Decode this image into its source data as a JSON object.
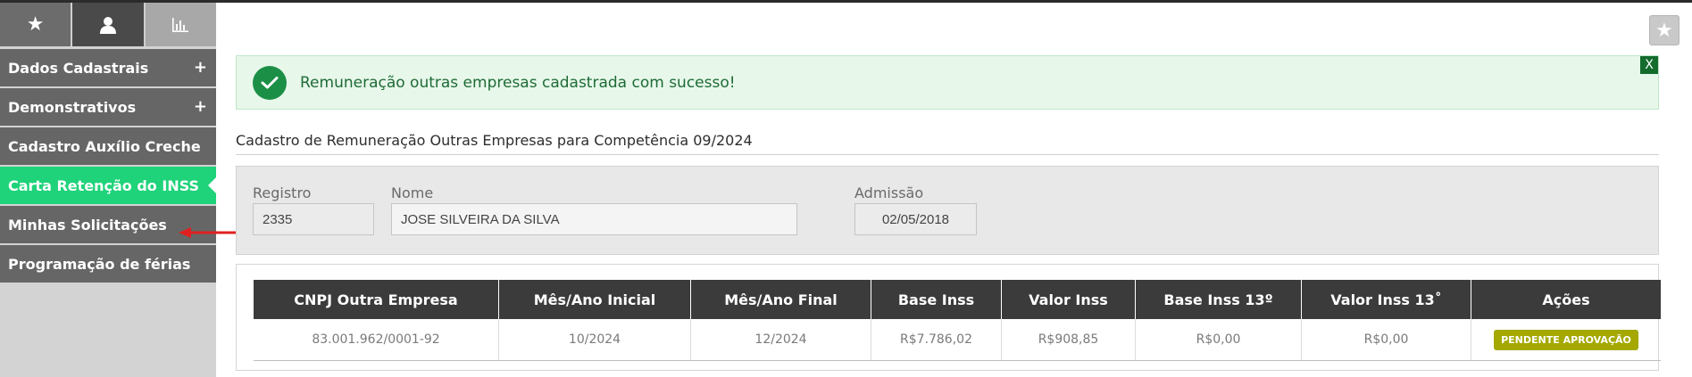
{
  "sidebar": {
    "tabs": [
      {
        "icon": "star-icon",
        "glyph": "★"
      },
      {
        "icon": "user-icon",
        "glyph": "👤"
      },
      {
        "icon": "bar-chart-icon",
        "glyph": "📊"
      }
    ],
    "items": [
      {
        "label": "Dados Cadastrais",
        "expand": "+"
      },
      {
        "label": "Demonstrativos",
        "expand": "+"
      },
      {
        "label": "Cadastro Auxílio Creche"
      },
      {
        "label": "Carta Retenção do INSS"
      },
      {
        "label": "Minhas Solicitações"
      },
      {
        "label": "Programação de férias"
      }
    ]
  },
  "alert": {
    "message": "Remuneração outras empresas cadastrada com sucesso!",
    "close_label": "X"
  },
  "favorite": {
    "glyph": "★"
  },
  "section": {
    "title": "Cadastro de Remuneração Outras Empresas para Competência 09/2024"
  },
  "form": {
    "registro": {
      "label": "Registro",
      "value": "2335"
    },
    "nome": {
      "label": "Nome",
      "value": "JOSE SILVEIRA DA SILVA"
    },
    "admissao": {
      "label": "Admissão",
      "value": "02/05/2018"
    }
  },
  "table": {
    "headers": [
      "CNPJ Outra Empresa",
      "Mês/Ano Inicial",
      "Mês/Ano Final",
      "Base Inss",
      "Valor Inss",
      "Base Inss 13º",
      "Valor Inss 13˚",
      "Ações"
    ],
    "rows": [
      {
        "cnpj": "83.001.962/0001-92",
        "inicial": "10/2024",
        "final": "12/2024",
        "base_inss": "R$7.786,02",
        "valor_inss": "R$908,85",
        "base_inss_13": "R$0,00",
        "valor_inss_13": "R$0,00",
        "acao": "PENDENTE APROVAÇÃO"
      }
    ]
  },
  "colors": {
    "active_menu": "#1fd37a",
    "menu_bg": "#666666",
    "success_bg": "#e7f7ea",
    "success_icon": "#1c8f47",
    "badge": "#a4a800",
    "table_header": "#3b3b3b",
    "annotation_arrow": "#e02020"
  }
}
